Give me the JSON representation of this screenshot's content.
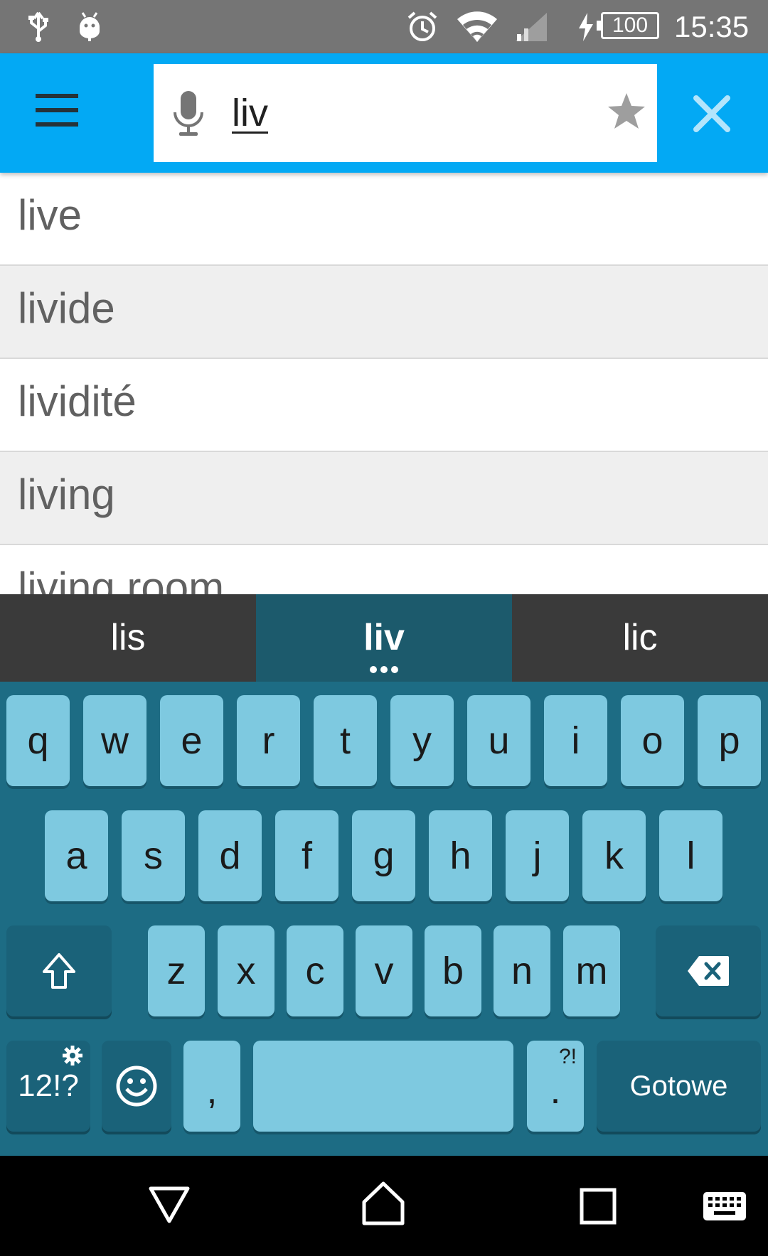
{
  "status_bar": {
    "icons": [
      "usb-icon",
      "android-debug-icon",
      "alarm-icon",
      "wifi-icon",
      "signal-icon",
      "charging-icon"
    ],
    "battery": "100",
    "time": "15:35"
  },
  "search": {
    "query": "liv",
    "icons": [
      "menu-icon",
      "microphone-icon",
      "star-icon",
      "close-icon"
    ]
  },
  "suggestions": [
    "live",
    "livide",
    "lividité",
    "living",
    "living room"
  ],
  "keyboard": {
    "candidates": [
      "lis",
      "liv",
      "lic"
    ],
    "row1": [
      "q",
      "w",
      "e",
      "r",
      "t",
      "y",
      "u",
      "i",
      "o",
      "p"
    ],
    "row2": [
      "a",
      "s",
      "d",
      "f",
      "g",
      "h",
      "j",
      "k",
      "l"
    ],
    "row3": [
      "z",
      "x",
      "c",
      "v",
      "b",
      "n",
      "m"
    ],
    "symbols_label": "12!?",
    "comma_label": ",",
    "period_label": ".",
    "period_hint": "?!",
    "done_label": "Gotowe",
    "icons": [
      "shift-icon",
      "backspace-icon",
      "settings-icon",
      "emoji-icon"
    ]
  },
  "nav_bar": {
    "icons": [
      "back-icon",
      "home-icon",
      "recents-icon",
      "keyboard-switch-icon"
    ]
  },
  "colors": {
    "app_bar": "#03a9f4",
    "keyboard_bg": "#1d6c84",
    "key": "#7ec9e0",
    "close_icon": "#4fc3f7"
  }
}
